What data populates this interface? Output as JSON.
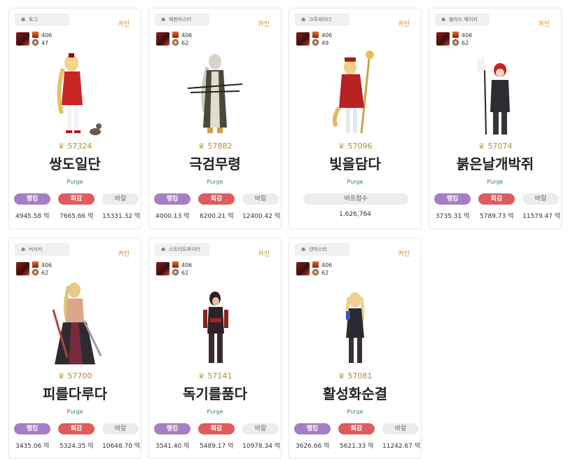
{
  "server_label": "카인",
  "cards": [
    {
      "class_name": "토그",
      "stat1": "406",
      "stat2": "47",
      "fame": "57324",
      "name": "쌍도일단",
      "adventure": "Purge",
      "pills": [
        "랭킹",
        "회감",
        "바칼"
      ],
      "values": [
        "4945.58 억",
        "7665.66 억",
        "15331.32 억"
      ]
    },
    {
      "class_name": "웨펀마스터",
      "stat1": "406",
      "stat2": "62",
      "fame": "57882",
      "name": "극검무령",
      "adventure": "Purge",
      "pills": [
        "랭킹",
        "회감",
        "바칼"
      ],
      "values": [
        "4000.13 억",
        "6200.21 억",
        "12400.42 억"
      ]
    },
    {
      "class_name": "크루세이더",
      "stat1": "406",
      "stat2": "49",
      "fame": "57096",
      "name": "빛을담다",
      "adventure": "Purge",
      "buff_label": "버프점수",
      "buff_value": "1,626,764"
    },
    {
      "class_name": "블러드 메이지",
      "stat1": "406",
      "stat2": "62",
      "fame": "57074",
      "name": "붉은날개박쥐",
      "adventure": "Purge",
      "pills": [
        "랭킹",
        "회감",
        "바칼"
      ],
      "values": [
        "3735.31 억",
        "5789.73 억",
        "11579.47 억"
      ]
    },
    {
      "class_name": "버서커",
      "stat1": "406",
      "stat2": "62",
      "fame": "57700",
      "name": "피를다루다",
      "adventure": "Purge",
      "pills": [
        "랭킹",
        "회감",
        "바칼"
      ],
      "values": [
        "3435.06 억",
        "5324.35 억",
        "10648.70 억"
      ]
    },
    {
      "class_name": "스트리트파이터",
      "stat1": "406",
      "stat2": "62",
      "fame": "57141",
      "name": "독기를품다",
      "adventure": "Purge",
      "pills": [
        "랭킹",
        "회감",
        "바칼"
      ],
      "values": [
        "3541.40 억",
        "5489.17 억",
        "10978.34 억"
      ]
    },
    {
      "class_name": "넨마스터",
      "stat1": "406",
      "stat2": "62",
      "fame": "57081",
      "name": "활성화순결",
      "adventure": "Purge",
      "pills": [
        "랭킹",
        "회감",
        "바칼"
      ],
      "values": [
        "3626.66 억",
        "5621.33 억",
        "11242.67 억"
      ]
    }
  ]
}
